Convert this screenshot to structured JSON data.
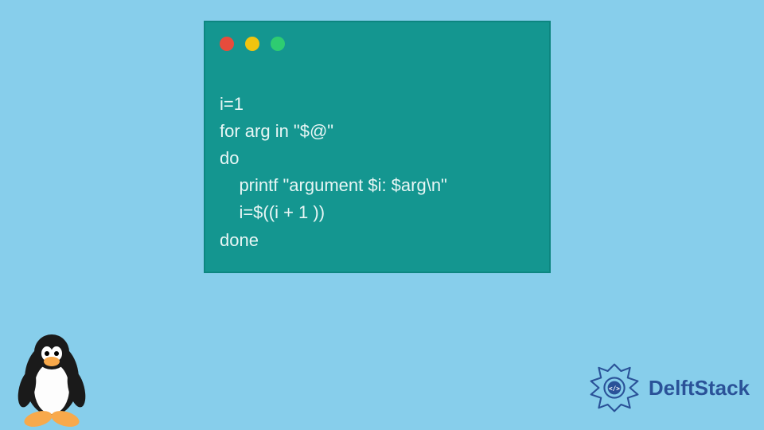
{
  "code_window": {
    "lines": [
      "i=1",
      "for arg in \"$@\"",
      "do",
      "    printf \"argument $i: $arg\\n\"",
      "    i=$((i + 1 ))",
      "done"
    ]
  },
  "branding": {
    "name": "DelftStack",
    "logo_icon": "delftstack-logo-icon"
  },
  "footer_icon": "tux-penguin-icon",
  "colors": {
    "background": "#87ceeb",
    "window": "#149690",
    "brand": "#2a5298"
  }
}
